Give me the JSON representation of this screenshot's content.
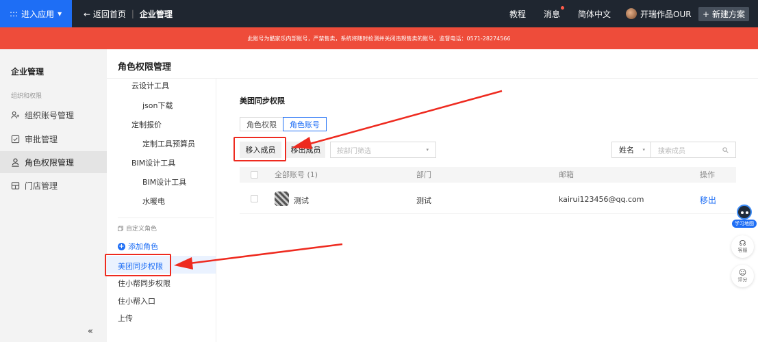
{
  "topbar": {
    "app_button": "进入应用",
    "grid_glyph": ":::",
    "caret": "▾",
    "back": "← 返回首页",
    "separator": "|",
    "section": "企业管理",
    "nav": [
      "教程",
      "消息",
      "简体中文"
    ],
    "user": "开瑞作品OUR",
    "new_button": "新建方案",
    "new_plus": "+"
  },
  "warning": "此账号为酷家乐内部账号，严禁售卖，系统将随时检测并关闭违规售卖的账号。监督电话：0571-28274566",
  "sidebar": {
    "title": "企业管理",
    "group": "组织和权限",
    "items": [
      "组织账号管理",
      "审批管理",
      "角色权限管理",
      "门店管理"
    ],
    "collapse": "«"
  },
  "page": {
    "title": "角色权限管理"
  },
  "roles": {
    "tree": [
      "云设计工具",
      "json下载",
      "定制报价",
      "定制工具预算员",
      "BIM设计工具",
      "BIM设计工具",
      "水暖电"
    ],
    "custom_label": "自定义角色",
    "add": "添加角色",
    "custom": [
      "美团同步权限",
      "住小帮同步权限",
      "住小帮入口",
      "上传"
    ]
  },
  "main": {
    "section_title": "美团同步权限",
    "tabs": [
      "角色权限",
      "角色账号"
    ],
    "add_member": "移入成员",
    "remove_member": "移出成员",
    "dept_placeholder": "按部门筛选",
    "filter_field": "姓名",
    "search_placeholder": "搜索成员",
    "select_caret": "▾",
    "table": {
      "headers": [
        "全部账号 (1)",
        "部门",
        "邮箱",
        "操作"
      ],
      "rows": [
        {
          "name": "测试",
          "dept": "测试",
          "email": "kairui123456@qq.com",
          "action": "移出"
        }
      ]
    }
  },
  "floating": {
    "robot_label": "学习地图",
    "service": "客服",
    "service_glyph": "☊",
    "rate": "评分",
    "rate_glyph": "☺"
  }
}
